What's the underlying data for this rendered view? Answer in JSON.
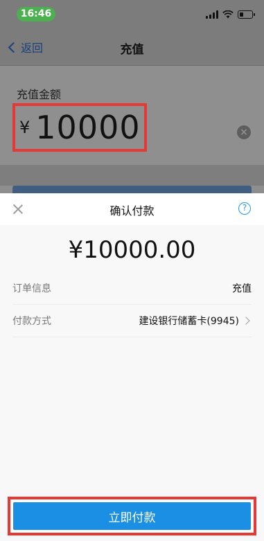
{
  "status_bar": {
    "time": "16:46"
  },
  "nav": {
    "back_label": "返回",
    "title": "充值"
  },
  "amount": {
    "label": "充值金额",
    "currency": "¥",
    "value": "10000"
  },
  "sheet": {
    "title": "确认付款",
    "help_glyph": "?",
    "pay_amount": "¥10000.00",
    "rows": [
      {
        "label": "订单信息",
        "value": "充值"
      },
      {
        "label": "付款方式",
        "value": "建设银行储蓄卡(9945)"
      }
    ],
    "pay_button_label": "立即付款"
  },
  "colors": {
    "accent_blue": "#1a8fe3",
    "highlight_red": "#e53935",
    "status_green": "#4caf50"
  },
  "icons": [
    "back-chevron-icon",
    "signal-icon",
    "wifi-icon",
    "battery-icon",
    "clear-icon",
    "close-icon",
    "help-icon",
    "chevron-right-icon"
  ]
}
